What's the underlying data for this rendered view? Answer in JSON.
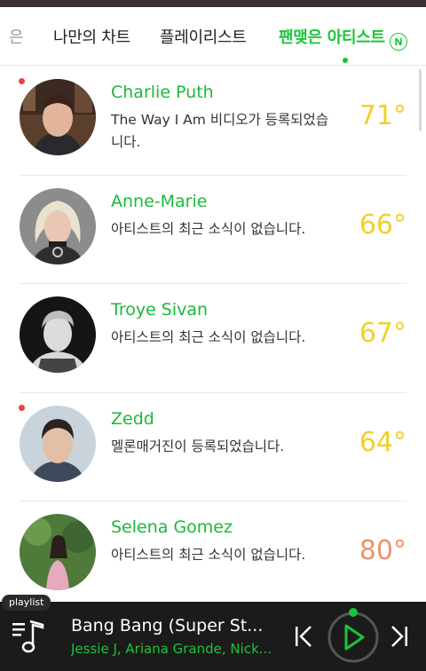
{
  "tabs": [
    {
      "label": "은",
      "state": "faded"
    },
    {
      "label": "나만의 차트",
      "state": "normal"
    },
    {
      "label": "플레이리스트",
      "state": "normal"
    },
    {
      "label": "팬맺은 아티스트",
      "state": "active"
    }
  ],
  "tabs_badge": "N",
  "artists": [
    {
      "name": "Charlie Puth",
      "desc": "The Way I Am 비디오가 등록되었습니다.",
      "temp": "71°",
      "temp_color": "#f2cf2a",
      "new": true
    },
    {
      "name": "Anne-Marie",
      "desc": "아티스트의 최근 소식이 없습니다.",
      "temp": "66°",
      "temp_color": "#f2cf2a",
      "new": false
    },
    {
      "name": "Troye Sivan",
      "desc": "아티스트의 최근 소식이 없습니다.",
      "temp": "67°",
      "temp_color": "#f2cf2a",
      "new": false
    },
    {
      "name": "Zedd",
      "desc": "멜론매거진이 등록되었습니다.",
      "temp": "64°",
      "temp_color": "#f2cf2a",
      "new": true
    },
    {
      "name": "Selena Gomez",
      "desc": "아티스트의 최근 소식이 없습니다.",
      "temp": "80°",
      "temp_color": "#f0906a",
      "new": false
    }
  ],
  "player": {
    "tag": "playlist",
    "title": "Bang Bang (Super St...",
    "artist": "Jessie J, Ariana Grande, Nick...",
    "accent": "#1cc43a"
  },
  "icons": [
    "playlist-icon",
    "previous-icon",
    "play-icon",
    "next-icon"
  ]
}
